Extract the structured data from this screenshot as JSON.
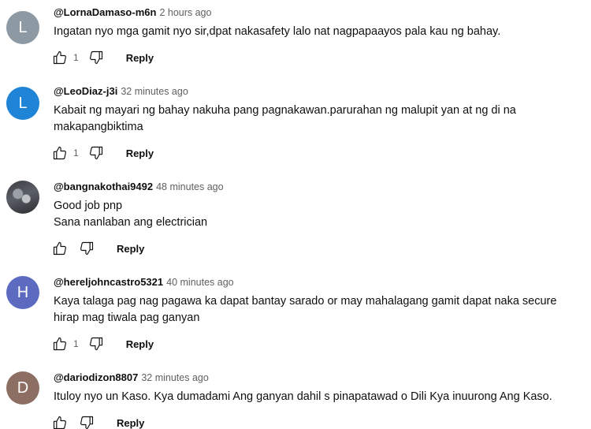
{
  "comments": [
    {
      "avatar": {
        "type": "letter",
        "letter": "L",
        "color": "#8d9aa4"
      },
      "author": "@LornaDamaso-m6n",
      "time": "2 hours ago",
      "lines": [
        "Ingatan nyo mga gamit nyo sir,dpat nakasafety lalo nat nagpapaayos pala kau ng bahay."
      ],
      "likes": "1",
      "reply_label": "Reply"
    },
    {
      "avatar": {
        "type": "letter",
        "letter": "L",
        "color": "#1f84d6"
      },
      "author": "@LeoDiaz-j3i",
      "time": "32 minutes ago",
      "lines": [
        "Kabait ng mayari ng bahay nakuha pang pagnakawan.parurahan ng malupit yan at ng di na",
        "makapangbiktima"
      ],
      "likes": "1",
      "reply_label": "Reply"
    },
    {
      "avatar": {
        "type": "photo",
        "icon": "user-photo"
      },
      "author": "@bangnakothai9492",
      "time": "48 minutes ago",
      "lines": [
        "Good job pnp",
        "Sana nanlaban ang electrician"
      ],
      "likes": "",
      "reply_label": "Reply"
    },
    {
      "avatar": {
        "type": "letter",
        "letter": "H",
        "color": "#5c6bc0"
      },
      "author": "@hereljohncastro5321",
      "time": "40 minutes ago",
      "lines": [
        "Kaya talaga pag nag pagawa ka dapat bantay sarado or may mahalagang gamit dapat naka secure",
        "hirap mag tiwala pag ganyan"
      ],
      "likes": "1",
      "reply_label": "Reply"
    },
    {
      "avatar": {
        "type": "letter",
        "letter": "D",
        "color": "#8d6e63"
      },
      "author": "@dariodizon8807",
      "time": "32 minutes ago",
      "lines": [
        "Ituloy nyo un Kaso. Kya dumadami Ang ganyan dahil s pinapatawad o Dili Kya inuurong Ang Kaso."
      ],
      "likes": "",
      "reply_label": "Reply"
    }
  ]
}
